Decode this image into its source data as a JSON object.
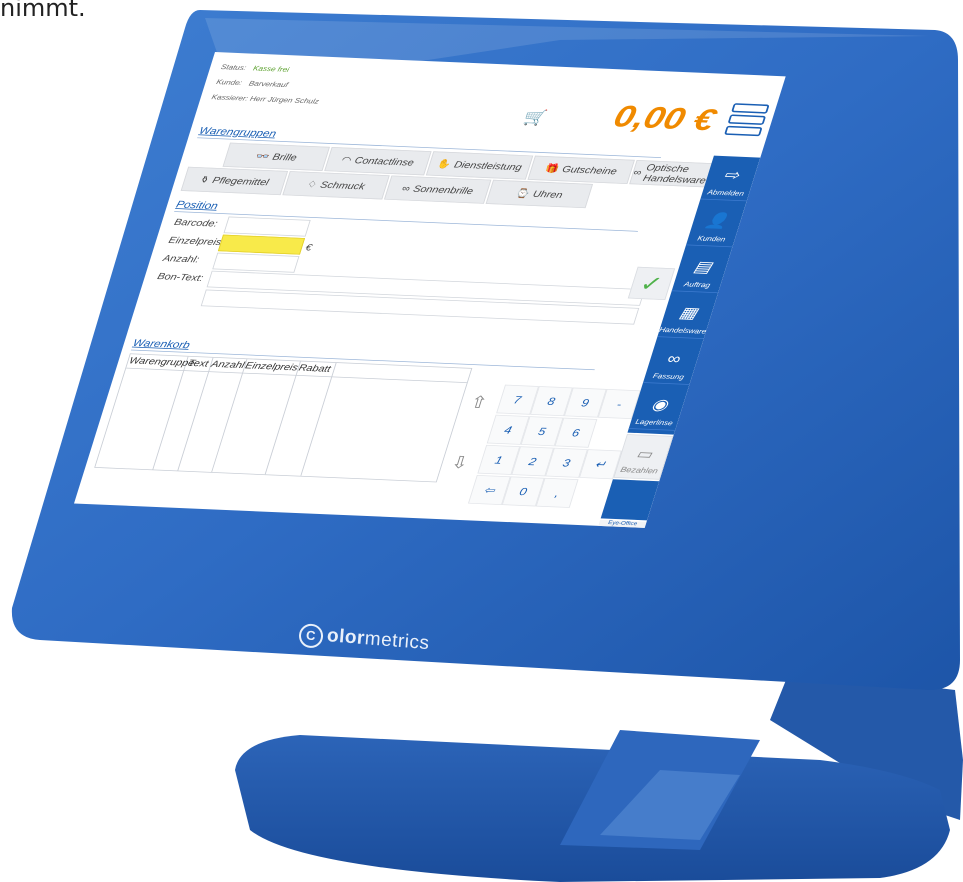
{
  "caption": "nimmt.",
  "brand": {
    "bold": "olor",
    "light": "metrics",
    "mark": "C"
  },
  "status": {
    "status_label": "Status:",
    "status_value": "Kasse frei",
    "kunde_label": "Kunde:",
    "kunde_value": "Barverkauf",
    "kassierer": "Kassierer: Herr Jürgen Schulz"
  },
  "total": "0,00 €",
  "warengruppen": {
    "title": "Warengruppen",
    "items": [
      {
        "label": "Brille",
        "icon": "glasses-icon",
        "glyph": "👓"
      },
      {
        "label": "Contactlinse",
        "icon": "contact-lens-icon",
        "glyph": "◠"
      },
      {
        "label": "Dienstleistung",
        "icon": "handshake-icon",
        "glyph": "✋"
      },
      {
        "label": "Gutscheine",
        "icon": "gift-icon",
        "glyph": "🎁"
      },
      {
        "label": "Optische Handelsware",
        "icon": "binoculars-icon",
        "glyph": "∞"
      },
      {
        "label": "Pflegemittel",
        "icon": "bottle-icon",
        "glyph": "⚱"
      },
      {
        "label": "Schmuck",
        "icon": "diamond-icon",
        "glyph": "♢"
      },
      {
        "label": "Sonnenbrille",
        "icon": "sunglasses-icon",
        "glyph": "∞"
      },
      {
        "label": "Uhren",
        "icon": "watch-icon",
        "glyph": "⌚"
      }
    ]
  },
  "position": {
    "title": "Position",
    "barcode": "Barcode:",
    "einzelpreis": "Einzelpreis:",
    "currency": "€",
    "anzahl": "Anzahl:",
    "bontext": "Bon-Text:"
  },
  "warenkorb": {
    "title": "Warenkorb",
    "columns": [
      "Warengruppe",
      "Text",
      "Anzahl",
      "Einzelpreis",
      "Rabatt"
    ]
  },
  "keypad": [
    "7",
    "8",
    "9",
    "-",
    "4",
    "5",
    "6",
    "1",
    "2",
    "3",
    "↵",
    "⇦",
    "0",
    ","
  ],
  "sidebar": [
    {
      "label": "Abmelden",
      "icon": "logout-icon",
      "glyph": "⇨"
    },
    {
      "label": "Kunden",
      "icon": "user-add-icon",
      "glyph": "👤"
    },
    {
      "label": "Auftrag",
      "icon": "order-icon",
      "glyph": "▤"
    },
    {
      "label": "Handelsware",
      "icon": "goods-icon",
      "glyph": "▦"
    },
    {
      "label": "Fassung",
      "icon": "frame-icon",
      "glyph": "∞"
    },
    {
      "label": "Lagerlinse",
      "icon": "lens-icon",
      "glyph": "◉"
    }
  ],
  "pay_label": "Bezahlen",
  "eyeoffice": "Eye-Office"
}
